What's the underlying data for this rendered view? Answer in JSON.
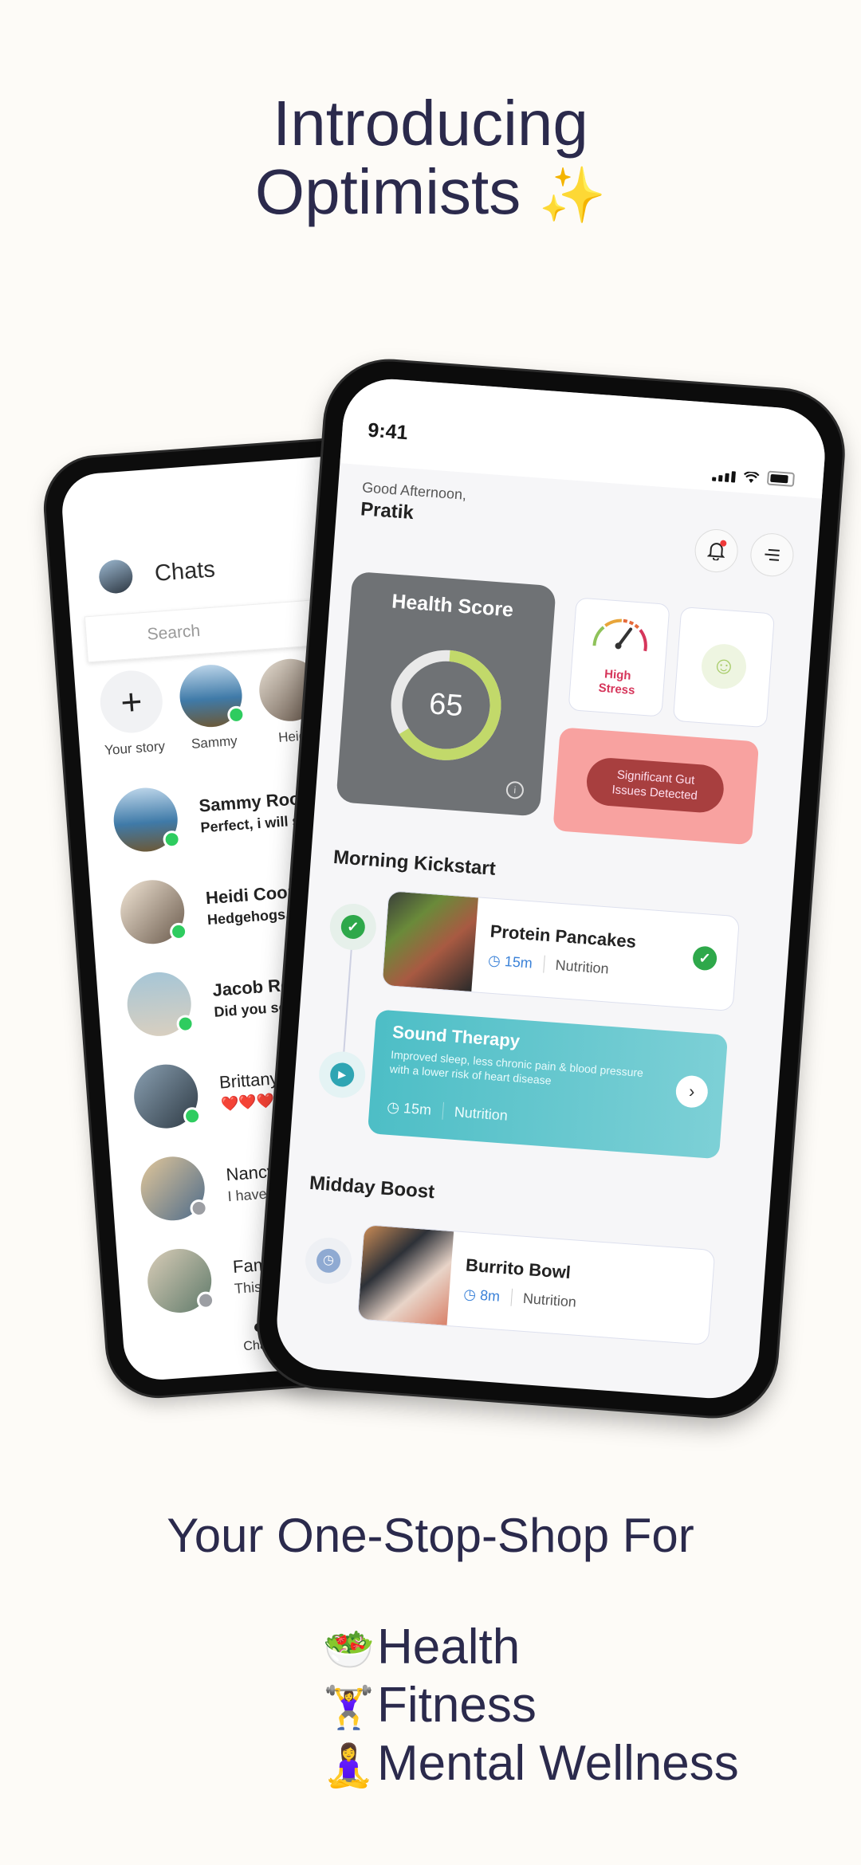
{
  "hero": {
    "title_line1": "Introducing",
    "title_line2": "Optimists",
    "sparkle": "✨"
  },
  "chats_app": {
    "title": "Chats",
    "search_placeholder": "Search",
    "stories": [
      {
        "label": "Your story",
        "icon": "+"
      },
      {
        "label": "Sammy",
        "online": true
      },
      {
        "label": "Heidi",
        "online": false
      }
    ],
    "conversations": [
      {
        "name": "Sammy Roo",
        "message": "Perfect, i will se",
        "status": "online",
        "unread": true
      },
      {
        "name": "Heidi Coope",
        "message": "Hedgehogs...",
        "status": "online",
        "unread": true
      },
      {
        "name": "Jacob Ro",
        "message": "Did you se",
        "status": "online",
        "unread": true
      },
      {
        "name": "Brittany",
        "message": "❤️❤️❤️",
        "status": "online",
        "unread": false
      },
      {
        "name": "Nancy",
        "message": "I have",
        "status": "offline",
        "unread": false
      },
      {
        "name": "Fam",
        "message": "This",
        "status": "offline",
        "unread": false
      }
    ],
    "bottom_nav": {
      "label": "Chats",
      "icon": "chat-bubble-icon"
    },
    "colors": {
      "online": "#2ecc5f",
      "offline": "#9c9ea3"
    }
  },
  "health_app": {
    "status_bar": {
      "time": "9:41"
    },
    "greeting": "Good Afternoon,",
    "username": "Pratik",
    "health_score": {
      "title": "Health Score",
      "value": "65",
      "progress": 0.65
    },
    "stress": {
      "label_line1": "High",
      "label_line2": "Stress"
    },
    "mood": {
      "icon": "☺"
    },
    "gut_alert": {
      "line1": "Significant Gut",
      "line2": "Issues Detected"
    },
    "sections": [
      {
        "title": "Morning Kickstart",
        "tasks": [
          {
            "title": "Protein Pancakes",
            "duration": "15m",
            "category": "Nutrition",
            "state": "done"
          },
          {
            "title": "Sound Therapy",
            "description": "Improved sleep, less chronic pain & blood pressure with a lower risk of heart disease",
            "duration": "15m",
            "category": "Nutrition",
            "state": "active"
          }
        ]
      },
      {
        "title": "Midday Boost",
        "tasks": [
          {
            "title": "Burrito Bowl",
            "duration": "8m",
            "category": "Nutrition",
            "state": "pending"
          }
        ]
      }
    ],
    "colors": {
      "score_ring": "#c2d96a",
      "stress_text": "#d6365b",
      "gut_bg": "#f8a2a0",
      "gut_pill": "#a83f3f",
      "therapy": "#4dbec6",
      "done": "#2ea84a",
      "time_meta": "#3b82d8"
    }
  },
  "bottom": {
    "tagline": "Your One-Stop-Shop For",
    "features": [
      {
        "emoji": "🥗",
        "label": "Health"
      },
      {
        "emoji": "🏋️‍♀️",
        "label": "Fitness"
      },
      {
        "emoji": "🧘‍♀️",
        "label": "Mental Wellness"
      }
    ]
  }
}
